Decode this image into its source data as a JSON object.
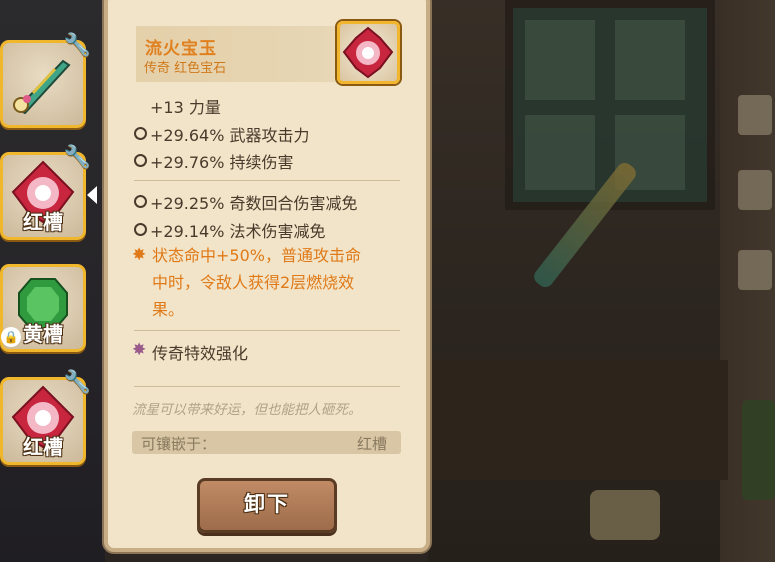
{
  "gem": {
    "name": "流火宝玉",
    "subtitle": "传奇 红色宝石"
  },
  "stats_primary": [
    {
      "text": "+13 力量",
      "icon": "none"
    },
    {
      "text": "+29.64% 武器攻击力",
      "icon": "circle-icon"
    },
    {
      "text": "+29.76% 持续伤害",
      "icon": "circle-icon"
    }
  ],
  "stats_secondary": [
    {
      "text": "+29.25% 奇数回合伤害减免",
      "icon": "circle-icon"
    },
    {
      "text": "+29.14% 法术伤害减免",
      "icon": "circle-icon"
    }
  ],
  "special_effect": {
    "line1": "状态命中+50%，普通攻击命",
    "line2": "中时，令敌人获得2层燃烧效",
    "line3": "果。",
    "color": "#e07a18"
  },
  "legend_effect": "传奇特效强化",
  "flavor_text": "流星可以带来好运，但也能把人砸死。",
  "socket": {
    "label": "可镶嵌于：",
    "value": "红槽"
  },
  "button": {
    "unequip": "卸下"
  },
  "slots": [
    {
      "label": "",
      "icon": "weapon-sword-icon"
    },
    {
      "label": "红槽",
      "icon": "red-gem-icon",
      "selected": true
    },
    {
      "label": "黄槽",
      "icon": "green-gem-icon",
      "locked": true
    },
    {
      "label": "红槽",
      "icon": "red-gem-icon"
    }
  ],
  "colors": {
    "accent_orange": "#e0801e",
    "slot_border": "#f0b62c",
    "panel_bg": "#f1e4c8"
  }
}
